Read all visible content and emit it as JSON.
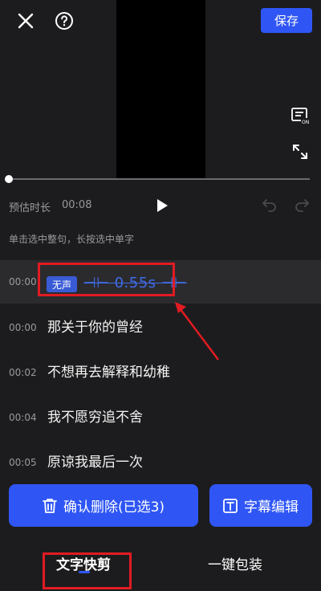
{
  "header": {
    "save_label": "保存"
  },
  "player": {
    "estimate_label": "预估时长",
    "estimate_value": "00:08",
    "progress": 0
  },
  "hint": "单击选中整句，长按选中单字",
  "rows": [
    {
      "time": "00:00",
      "badge": "无声",
      "duration": "⊣⊢ 0.55s ⊣⊢"
    },
    {
      "time": "00:00",
      "text": "那关于你的曾经"
    },
    {
      "time": "00:02",
      "text": "不想再去解释和幼稚"
    },
    {
      "time": "00:04",
      "text": "我不愿穷追不舍"
    },
    {
      "time": "00:05",
      "text": "原谅我最后一次"
    }
  ],
  "actions": {
    "confirm_delete_label": "确认删除(已选3)",
    "subtitle_edit_label": "字幕编辑"
  },
  "tabs": {
    "text_cut": "文字快剪",
    "one_click_pack": "一键包装"
  },
  "colors": {
    "accent": "#2f56f5",
    "highlight": "#e11b22",
    "background": "#1c1c1e"
  }
}
